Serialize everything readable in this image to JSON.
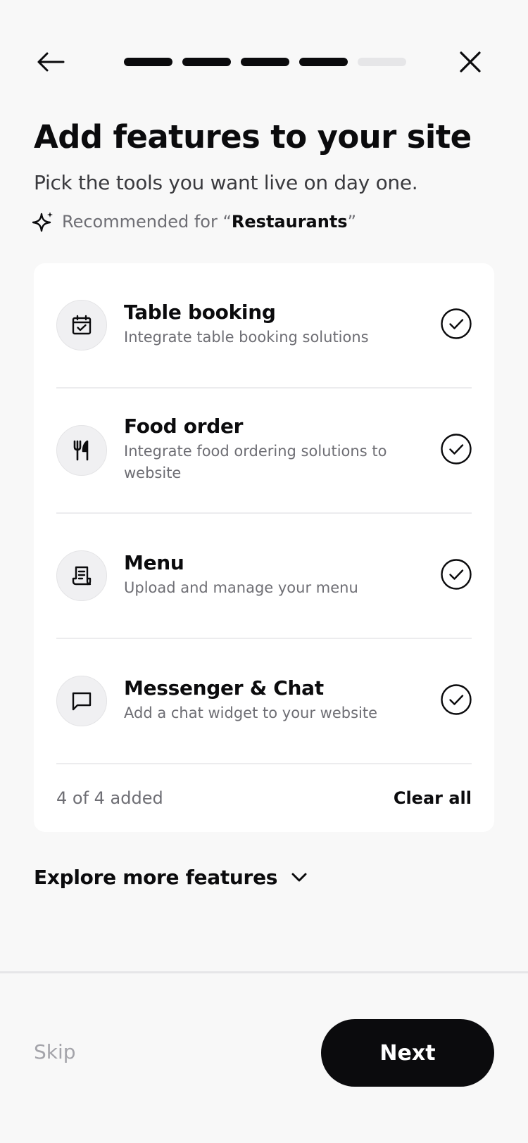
{
  "header": {
    "progress": {
      "current": 4,
      "total": 5
    }
  },
  "page": {
    "title": "Add features to your site",
    "subtitle": "Pick the tools you want live on day one.",
    "recommended_prefix": "Recommended for “",
    "recommended_category": "Restaurants",
    "recommended_suffix": "”"
  },
  "features": [
    {
      "name": "Table booking",
      "desc": "Integrate table booking solutions",
      "icon": "calendar-check-icon",
      "checked": true
    },
    {
      "name": "Food order",
      "desc": "Integrate food ordering solutions to website",
      "icon": "fork-knife-icon",
      "checked": true
    },
    {
      "name": "Menu",
      "desc": "Upload and manage your menu",
      "icon": "receipt-icon",
      "checked": true
    },
    {
      "name": "Messenger & Chat",
      "desc": "Add a chat widget to your website",
      "icon": "chat-bubble-icon",
      "checked": true
    }
  ],
  "summary": {
    "added_text": "4 of 4 added",
    "clear_label": "Clear all"
  },
  "explore": {
    "label": "Explore more features"
  },
  "footer": {
    "skip_label": "Skip",
    "next_label": "Next"
  }
}
